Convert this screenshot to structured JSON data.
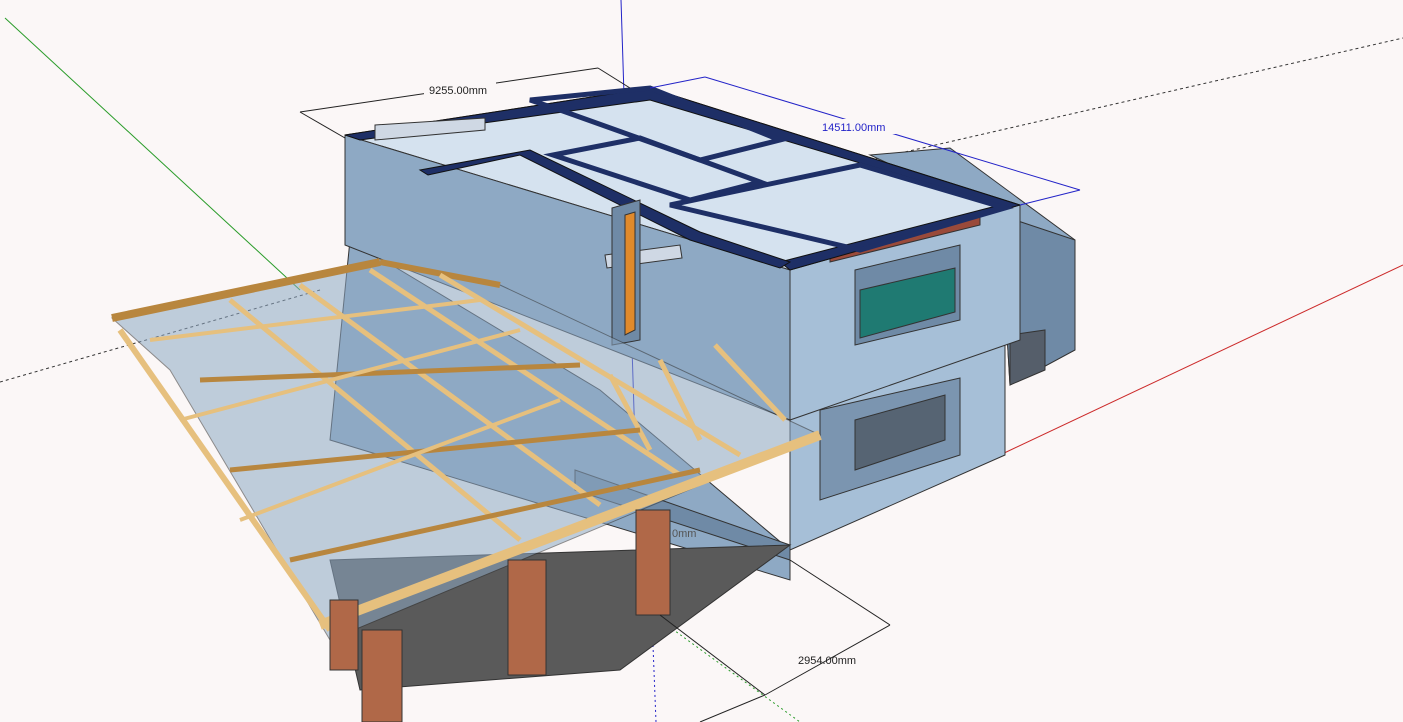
{
  "viewport": {
    "background": "#fbf7f7",
    "axes": {
      "red": "#cc2a2a",
      "green": "#2a9c2a",
      "blue": "#2323c8"
    }
  },
  "dimensions": {
    "width_label": "9255.00mm",
    "length_label": "14511.00mm",
    "offset_label": "2954.00mm",
    "partial_label": "0mm"
  },
  "colors": {
    "wall_light": "#a6bfd7",
    "wall_mid": "#8ea9c4",
    "wall_dark": "#6f8aa6",
    "wall_top": "#1e2f66",
    "timber": "#e6c07e",
    "timber_dark": "#b8863e",
    "brick": "#b06848",
    "water_green": "#1f7a72",
    "beam_red": "#9a4a3a"
  }
}
